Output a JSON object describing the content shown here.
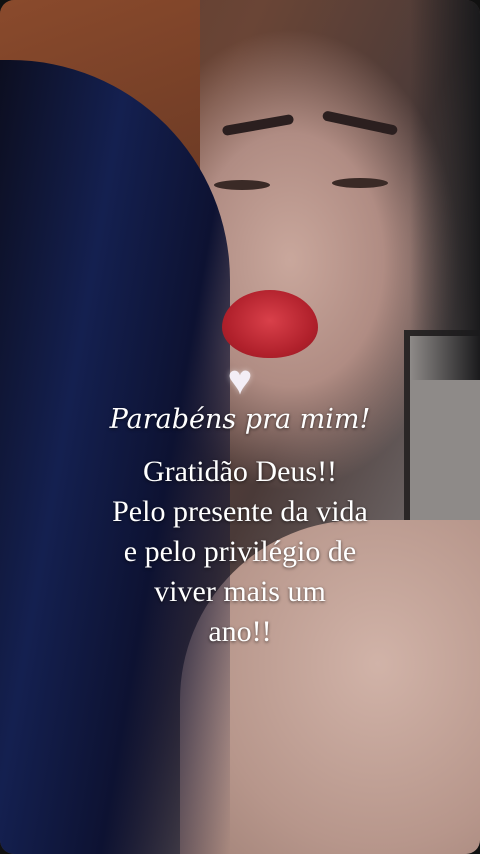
{
  "story": {
    "heart_glyph": "♥",
    "greeting": "Parabéns pra mim!",
    "message_lines": [
      "Gratidão Deus!!",
      "Pelo presente da vida",
      "e pelo privilégio de",
      "viver mais um",
      "ano!!"
    ]
  },
  "colors": {
    "text": "#ffffff",
    "heart": "#f3eef6"
  }
}
